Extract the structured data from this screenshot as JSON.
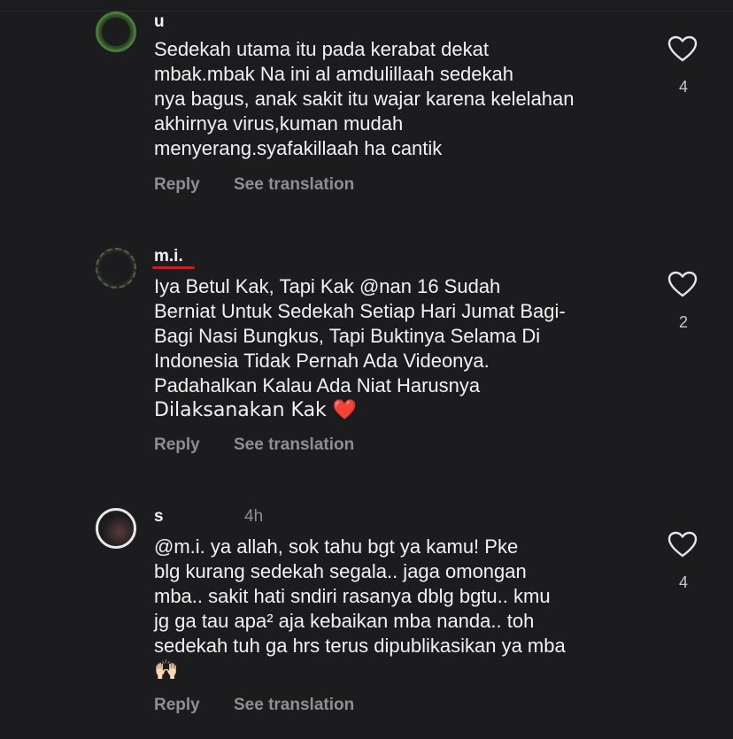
{
  "comments": [
    {
      "username": "u",
      "timestamp": "",
      "lines": [
        "Sedekah utama itu pada kerabat dekat",
        "mbak.mbak Na        ini al  amdulillaah sedekah",
        "nya bagus, anak sakit itu wajar karena kelelahan",
        "akhirnya virus,kuman mudah",
        "menyerang.syafakillaah ha          cantik"
      ],
      "reply_label": "Reply",
      "translate_label": "See translation",
      "likes": "4",
      "avatar_color": "#4a7a3a"
    },
    {
      "username": "m.i.",
      "timestamp": "",
      "lines": [
        "Iya Betul Kak, Tapi Kak @nan            16 Sudah",
        "Berniat Untuk Sedekah Setiap Hari Jumat Bagi-",
        "Bagi Nasi Bungkus, Tapi Buktinya Selama Di",
        "Indonesia Tidak Pernah Ada Videonya.",
        "Padahalkan Kalau Ada Niat Harusnya",
        "Dilaksanakan Kak ❤️"
      ],
      "reply_label": "Reply",
      "translate_label": "See translation",
      "likes": "2",
      "avatar_color": "#3a3f35"
    },
    {
      "username": "s",
      "timestamp": "4h",
      "lines": [
        "@m.i.          ya allah, sok tahu bgt ya kamu! Pke",
        "blg kurang sedekah segala.. jaga omongan",
        "mba.. sakit hati sndiri rasanya dblg bgtu.. kmu",
        "jg ga tau apa² aja kebaikan mba nanda.. toh",
        "sedekah tuh ga hrs terus dipublikasikan ya mba",
        "🙌🏻"
      ],
      "reply_label": "Reply",
      "translate_label": "See translation",
      "likes": "4",
      "avatar_color": "#e8e8e8"
    }
  ],
  "colors": {
    "background": "#1c1c1e",
    "text": "#f2f2f2",
    "secondary": "#8e8e93",
    "mention": "#c7d0e0",
    "underline_mark": "#e0141b"
  },
  "icons": {
    "like": "heart-outline-icon"
  }
}
